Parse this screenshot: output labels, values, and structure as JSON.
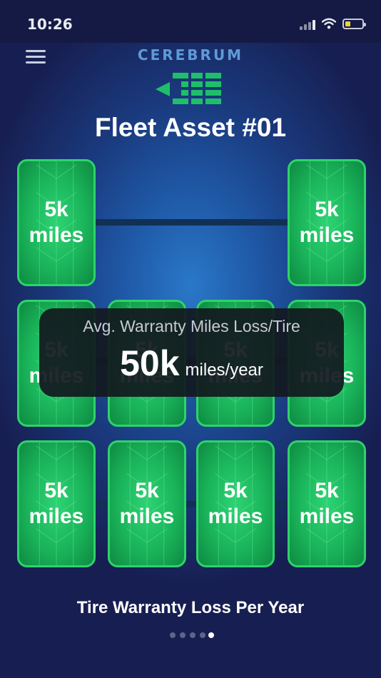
{
  "status_bar": {
    "time": "10:26"
  },
  "header": {
    "brand": "CEREBRUM",
    "title": "Fleet Asset #01"
  },
  "tires": {
    "t1": {
      "value": "5k",
      "unit": "miles"
    },
    "t2": {
      "value": "5k",
      "unit": "miles"
    },
    "t3": {
      "value": "5k",
      "unit": "miles"
    },
    "t4": {
      "value": "5k",
      "unit": "miles"
    },
    "t5": {
      "value": "5k",
      "unit": "miles"
    },
    "t6": {
      "value": "5k",
      "unit": "miles"
    },
    "t7": {
      "value": "5k",
      "unit": "miles"
    },
    "t8": {
      "value": "5k",
      "unit": "miles"
    },
    "t9": {
      "value": "5k",
      "unit": "miles"
    },
    "t10": {
      "value": "5k",
      "unit": "miles"
    }
  },
  "overlay": {
    "title": "Avg. Warranty Miles Loss/Tire",
    "value": "50k",
    "unit": "miles/year"
  },
  "footer": {
    "caption": "Tire Warranty Loss Per Year"
  },
  "pager": {
    "count": 5,
    "active_index": 4
  },
  "colors": {
    "tire_green": "#1ab45a",
    "tire_border": "#2dd36a",
    "brand_blue": "#5f9ad8",
    "background_dark": "#171f52"
  }
}
